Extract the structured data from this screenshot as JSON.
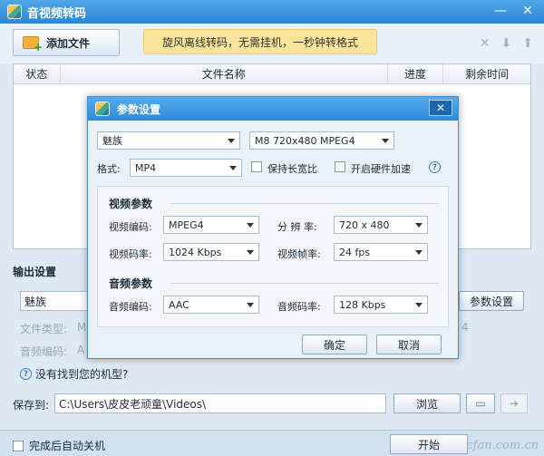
{
  "window": {
    "title": "音视频转码"
  },
  "toolbar": {
    "add_file": "添加文件",
    "promo": "旋风离线转码，无需挂机，一秒钟转格式"
  },
  "file_list": {
    "columns": [
      "状态",
      "文件名称",
      "进度",
      "剩余时间"
    ]
  },
  "output": {
    "title": "输出设置",
    "device": "魅族",
    "param_button": "参数设置",
    "file_type_label": "文件类型:",
    "file_type_partial": "M",
    "audio_codec_label": "音频编码:",
    "audio_codec_partial": "A",
    "right_partial": "4",
    "help_link": "没有找到您的机型?"
  },
  "save": {
    "label": "保存到:",
    "path": "C:\\Users\\皮皮老顽童\\Videos\\",
    "browse": "浏览"
  },
  "footer": {
    "auto_shutdown": "完成后自动关机",
    "start": "开始",
    "watermark": "cfan.com.cn"
  },
  "dialog": {
    "title": "参数设置",
    "brand": "魅族",
    "model": "M8 720x480 MPEG4",
    "format_label": "格式:",
    "format": "MP4",
    "keep_ratio": "保持长宽比",
    "hw_accel": "开启硬件加速",
    "video_section": "视频参数",
    "video_codec_label": "视频编码:",
    "video_codec": "MPEG4",
    "resolution_label": "分 辨 率:",
    "resolution": "720 x 480",
    "video_bitrate_label": "视频码率:",
    "video_bitrate": "1024 Kbps",
    "framerate_label": "视频帧率:",
    "framerate": "24 fps",
    "audio_section": "音频参数",
    "audio_codec_label": "音频编码:",
    "audio_codec": "AAC",
    "audio_bitrate_label": "音频码率:",
    "audio_bitrate": "128 Kbps",
    "ok": "确定",
    "cancel": "取消"
  }
}
